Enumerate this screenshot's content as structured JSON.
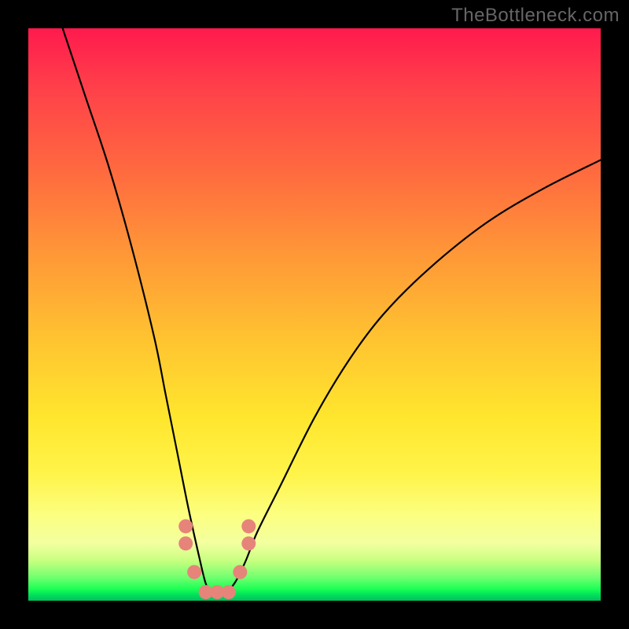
{
  "watermark": "TheBottleneck.com",
  "chart_data": {
    "type": "line",
    "title": "",
    "xlabel": "",
    "ylabel": "",
    "xlim": [
      0,
      100
    ],
    "ylim": [
      0,
      100
    ],
    "grid": false,
    "legend": false,
    "series": [
      {
        "name": "bottleneck-curve",
        "x": [
          6,
          10,
          14,
          18,
          22,
          24,
          26,
          28,
          30,
          31,
          32,
          33,
          34,
          36,
          38,
          40,
          44,
          50,
          56,
          62,
          70,
          80,
          90,
          100
        ],
        "values": [
          100,
          88,
          76,
          62,
          46,
          36,
          26,
          16,
          7,
          3,
          1,
          1,
          1,
          3,
          7,
          12,
          20,
          32,
          42,
          50,
          58,
          66,
          72,
          77
        ]
      }
    ],
    "markers": {
      "name": "trough-markers",
      "color": "#e6847a",
      "points": [
        {
          "x": 27.5,
          "y": 13
        },
        {
          "x": 27.5,
          "y": 10
        },
        {
          "x": 29,
          "y": 5
        },
        {
          "x": 31,
          "y": 1.5
        },
        {
          "x": 33,
          "y": 1.5
        },
        {
          "x": 35,
          "y": 1.5
        },
        {
          "x": 37,
          "y": 5
        },
        {
          "x": 38.5,
          "y": 10
        },
        {
          "x": 38.5,
          "y": 13
        }
      ]
    }
  }
}
